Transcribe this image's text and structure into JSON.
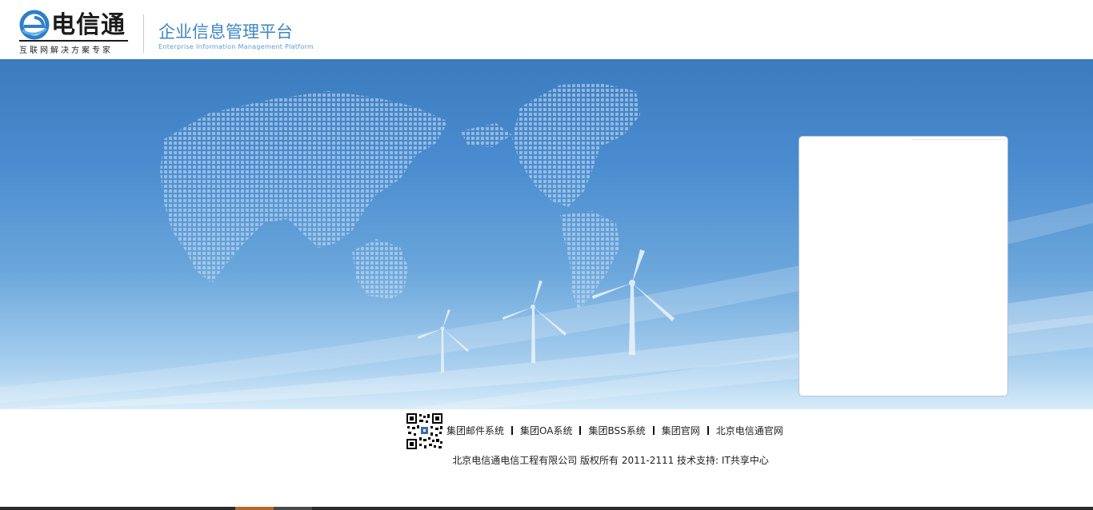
{
  "header": {
    "logo_title": "电信通",
    "logo_slogan": "互联网解决方案专家",
    "platform_title": "企业信息管理平台",
    "platform_subtitle": "Enterprise Information Management Platform"
  },
  "banner": {
    "decor": [
      "world-map-icon",
      "wind-turbine-icon"
    ]
  },
  "login": {},
  "footer": {
    "links": [
      "集团邮件系统",
      "集团OA系统",
      "集团BSS系统",
      "集团官网",
      "北京电信通官网"
    ],
    "copyright": "北京电信通电信工程有限公司 版权所有 2011-2111 技术支持: IT共享中心"
  },
  "colors": {
    "brand_blue": "#3e86c6",
    "banner_top": "#3b7cbf",
    "banner_bottom": "#d7ecf9"
  }
}
